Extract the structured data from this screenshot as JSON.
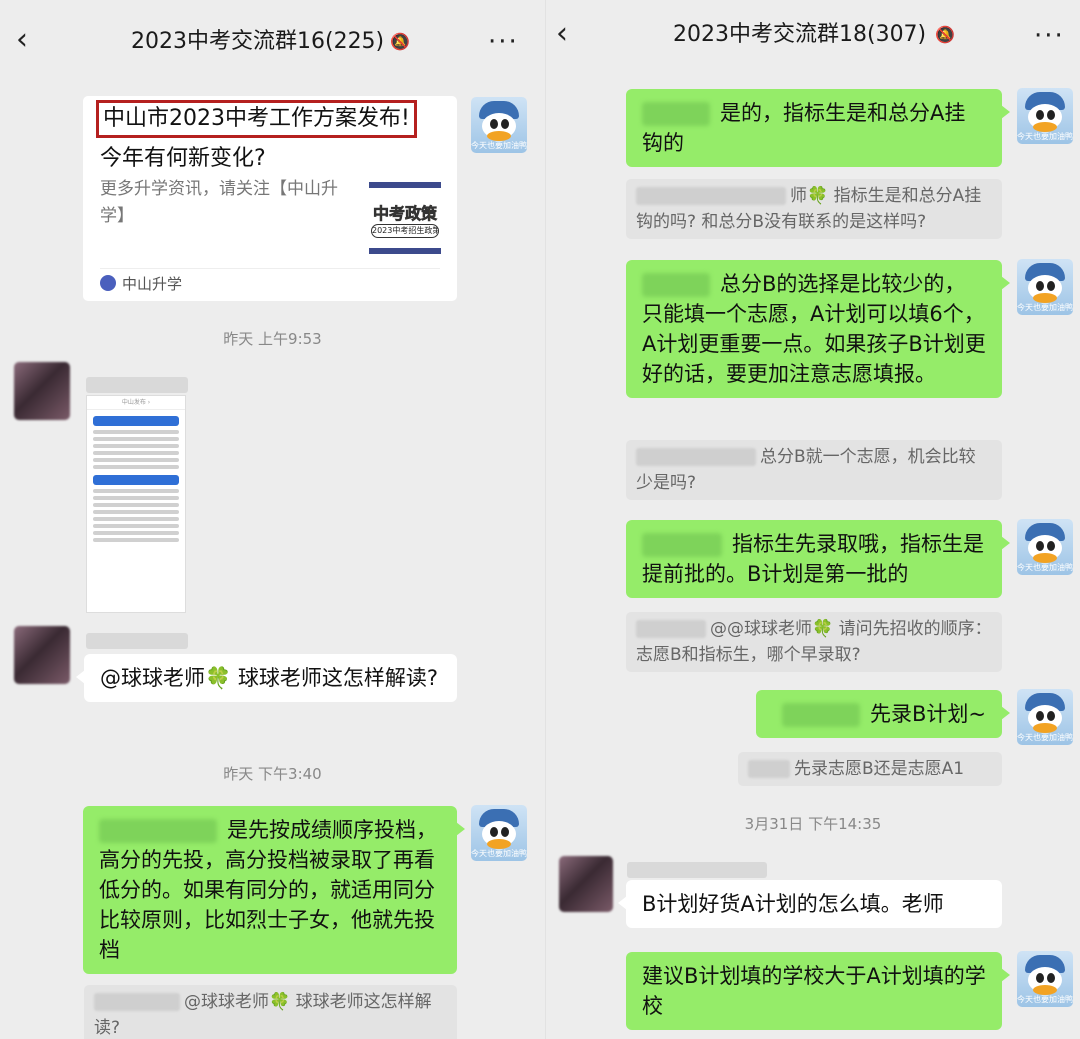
{
  "left": {
    "header": {
      "back_icon": "‹",
      "title": "2023中考交流群16(225)",
      "mute_icon": "🔕",
      "more_icon": "···"
    },
    "card": {
      "title": "中山市2023中考工作方案发布!",
      "subtitle": "今年有何新变化?",
      "desc": "更多升学资讯，请关注【中山升学】",
      "thumb_main": "中考政策",
      "thumb_sub": "2023中考招生政策",
      "source": "中山升学"
    },
    "ts1": "昨天 上午9:53",
    "shot_bar": "中山发布 ›",
    "msg_mention": "@球球老师🍀  球球老师这怎样解读?",
    "ts2": "昨天 下午3:40",
    "msg_reply": "是先按成绩顺序投档，高分的先投，高分投档被录取了再看低分的。如果有同分的，就适用同分比较原则，比如烈士子女，他就先投档",
    "quote_reply": "@球球老师🍀  球球老师这怎样解读?"
  },
  "right": {
    "header": {
      "back_icon": "‹",
      "title": "2023中考交流群18(307)",
      "mute_icon": "🔕",
      "more_icon": "···"
    },
    "m1": "是的，指标生是和总分A挂钩的",
    "q1": "师🍀 指标生是和总分A挂钩的吗? 和总分B没有联系的是这样吗?",
    "m2": "总分B的选择是比较少的，只能填一个志愿，A计划可以填6个，A计划更重要一点。如果孩子B计划更好的话，要更加注意志愿填报。",
    "q2": "总分B就一个志愿，机会比较少是吗?",
    "m3": "指标生先录取哦，指标生是提前批的。B计划是第一批的",
    "q3": "@@球球老师🍀 请问先招收的顺序：志愿B和指标生，哪个早录取?",
    "m4": "先录B计划~",
    "q4": "先录志愿B还是志愿A1",
    "ts": "3月31日 下午14:35",
    "m5": "B计划好货A计划的怎么填。老师",
    "m6": "建议B计划填的学校大于A计划填的学校"
  },
  "avatar_caption": "今天也要加油鸭"
}
